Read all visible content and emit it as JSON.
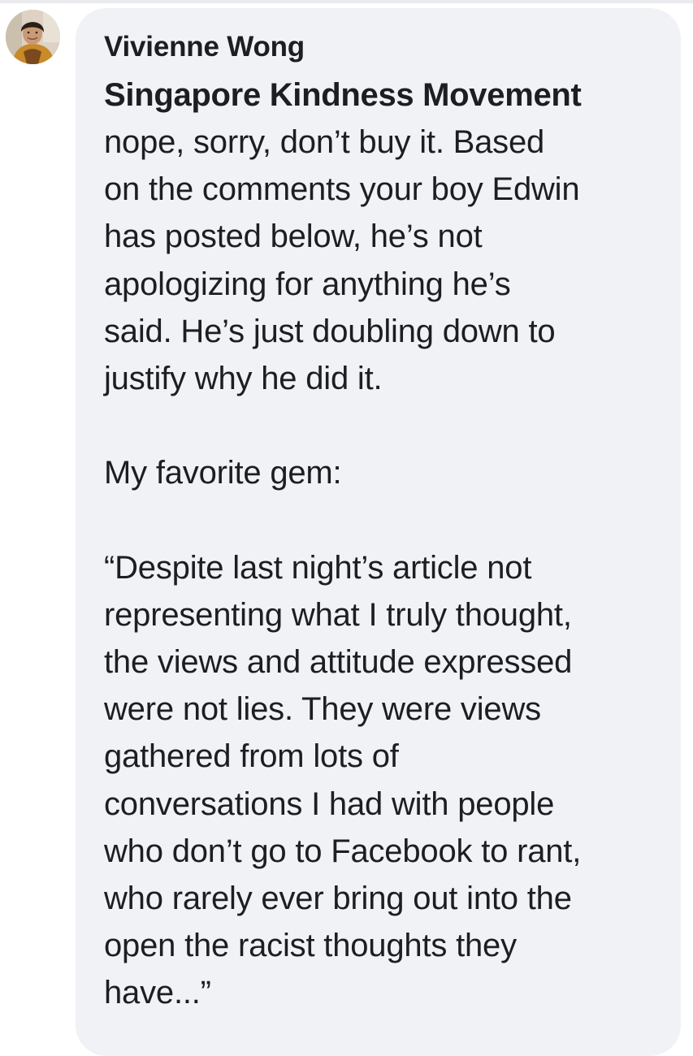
{
  "comment": {
    "author": "Vivienne Wong",
    "tagged_page": "Singapore Kindness Movement",
    "paragraph_1": [
      "nope, sorry, don’t buy it. Based",
      "on the comments your boy Edwin",
      "has posted below, he’s not",
      "apologizing for anything he’s",
      "said. He’s just doubling down to",
      "justify why he did it."
    ],
    "paragraph_2": [
      "My favorite gem:"
    ],
    "paragraph_3": [
      "“Despite last night’s article not",
      "representing what I truly thought,",
      "the views and attitude expressed",
      "were not lies. They were views",
      "gathered from lots of",
      "conversations I had with people",
      "who don’t go to Facebook to rant,",
      "who rarely ever bring out into the",
      "open the racist thoughts they",
      "have...”"
    ]
  },
  "colors": {
    "bubble_background": "#f0f2f5",
    "text": "#1c1e21"
  }
}
